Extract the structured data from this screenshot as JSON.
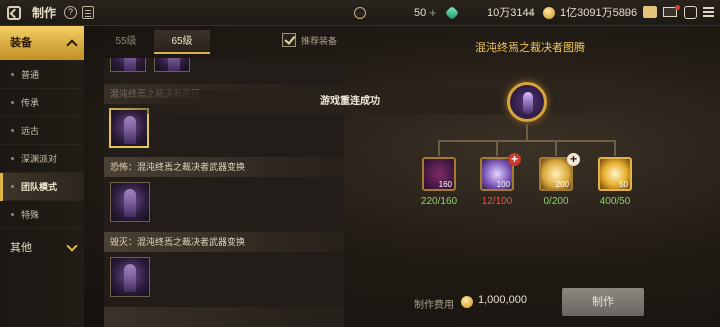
{
  "topbar": {
    "title": "制作",
    "help": "?",
    "currencies": [
      {
        "icon": "dollar-coin-icon",
        "value": "50"
      },
      {
        "icon": "green-gem-icon",
        "value": "10万3144"
      },
      {
        "icon": "gold-coin-icon",
        "value": "1亿3091万5896"
      }
    ],
    "colors": {
      "gold": "#e0b647",
      "accent": "#f0c75a"
    }
  },
  "sidebar": {
    "category_equipment": "装备",
    "items": [
      "普通",
      "传承",
      "远古",
      "深渊派对",
      "团队模式",
      "特殊"
    ],
    "active_item": "团队模式",
    "category_other": "其他"
  },
  "tabs": {
    "level55": "55级",
    "level65": "65级",
    "active": "65级"
  },
  "recommend_label": "推荐装备",
  "recommend_checked": true,
  "list": {
    "rows": [
      {
        "label": "混沌终焉之裁决者武器"
      },
      {
        "label": "恐怖：混沌终焉之裁决者武器变换"
      },
      {
        "label": "毁灭：混沌终焉之裁决者武器变换"
      }
    ]
  },
  "toast": "游戏重连成功",
  "craft": {
    "title": "混沌终焉之裁决者图腾",
    "materials": [
      {
        "icon": "dark-orb-icon",
        "count": "160",
        "quantity": "220/160",
        "status": "ok"
      },
      {
        "icon": "purple-crystal-icon",
        "count": "100",
        "quantity": "12/100",
        "status": "lack"
      },
      {
        "icon": "gold-cube-icon",
        "count": "200",
        "quantity": "0/200",
        "status": "lack"
      },
      {
        "icon": "gold-ring-icon",
        "count": "50",
        "quantity": "400/50",
        "status": "ok"
      }
    ],
    "cost_label": "制作费用",
    "cost_value": "1,000,000",
    "button": "制作"
  }
}
